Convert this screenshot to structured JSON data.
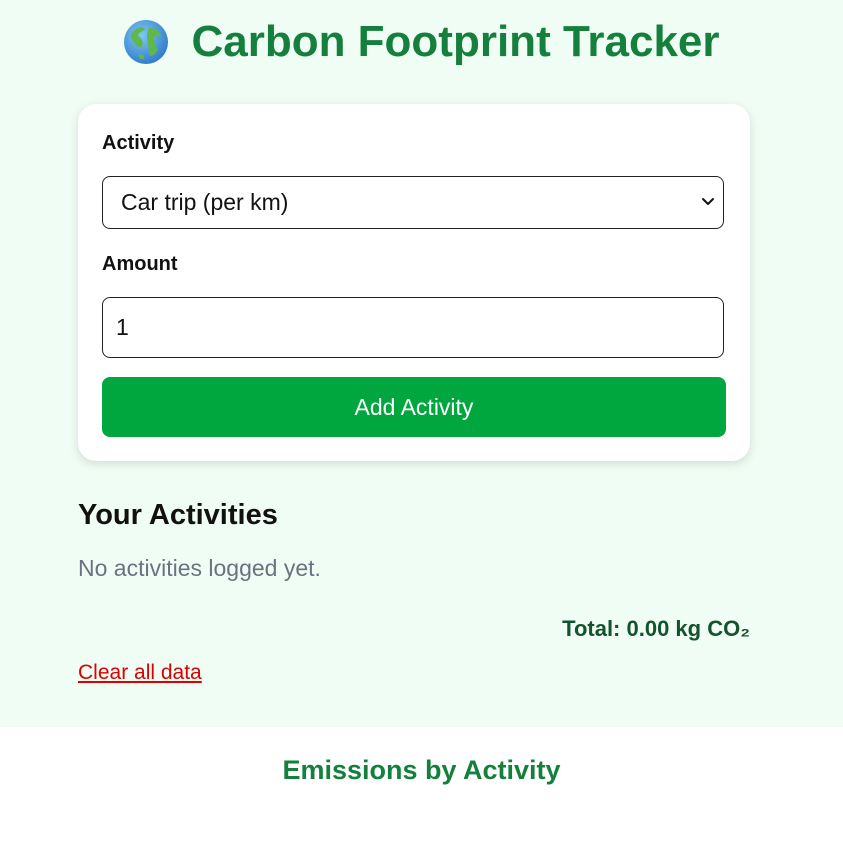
{
  "header": {
    "icon": "globe-icon",
    "title": "Carbon Footprint Tracker"
  },
  "form": {
    "activity_label": "Activity",
    "activity_selected": "Car trip (per km)",
    "amount_label": "Amount",
    "amount_value": "1",
    "submit_label": "Add Activity"
  },
  "activities": {
    "heading": "Your Activities",
    "empty_text": "No activities logged yet.",
    "total_text": "Total: 0.00 kg CO₂",
    "clear_label": "Clear all data"
  },
  "chart": {
    "title": "Emissions by Activity"
  },
  "colors": {
    "background": "#f0fdf4",
    "title_green": "#15803d",
    "button_green": "#00a63e",
    "total_green": "#14532d",
    "danger_red": "#dc0000",
    "muted_text": "#6b7280"
  }
}
